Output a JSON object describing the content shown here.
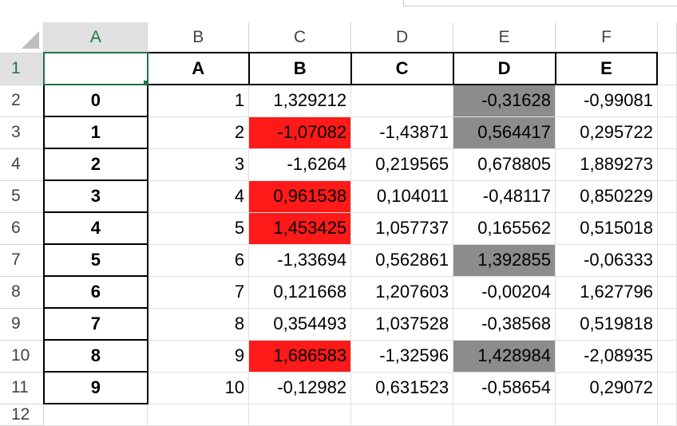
{
  "sheet": {
    "columns": [
      "A",
      "B",
      "C",
      "D",
      "E",
      "F"
    ],
    "active_column": "A",
    "active_row": "1",
    "header_row": {
      "number": "1",
      "index_cell": "",
      "labels": [
        "A",
        "B",
        "C",
        "D",
        "E"
      ]
    },
    "rows": [
      {
        "num": "2",
        "idx": "0",
        "cells": [
          "1",
          "1,329212",
          "",
          "-0,31628",
          "-0,99081"
        ]
      },
      {
        "num": "3",
        "idx": "1",
        "cells": [
          "2",
          "-1,07082",
          "-1,43871",
          "0,564417",
          "0,295722"
        ]
      },
      {
        "num": "4",
        "idx": "2",
        "cells": [
          "3",
          "-1,6264",
          "0,219565",
          "0,678805",
          "1,889273"
        ]
      },
      {
        "num": "5",
        "idx": "3",
        "cells": [
          "4",
          "0,961538",
          "0,104011",
          "-0,48117",
          "0,850229"
        ]
      },
      {
        "num": "6",
        "idx": "4",
        "cells": [
          "5",
          "1,453425",
          "1,057737",
          "0,165562",
          "0,515018"
        ]
      },
      {
        "num": "7",
        "idx": "5",
        "cells": [
          "6",
          "-1,33694",
          "0,562861",
          "1,392855",
          "-0,06333"
        ]
      },
      {
        "num": "8",
        "idx": "6",
        "cells": [
          "7",
          "0,121668",
          "1,207603",
          "-0,00204",
          "1,627796"
        ]
      },
      {
        "num": "9",
        "idx": "7",
        "cells": [
          "8",
          "0,354493",
          "1,037528",
          "-0,38568",
          "0,519818"
        ]
      },
      {
        "num": "10",
        "idx": "8",
        "cells": [
          "9",
          "1,686583",
          "-1,32596",
          "1,428984",
          "-2,08935"
        ]
      },
      {
        "num": "11",
        "idx": "9",
        "cells": [
          "10",
          "-0,12982",
          "0,631523",
          "-0,58654",
          "0,29072"
        ]
      }
    ],
    "partial_row_number": "12",
    "highlight_colors": {
      "red": "#ff1a1a",
      "gray": "#8c8c8c",
      "selection": "#217346"
    }
  }
}
